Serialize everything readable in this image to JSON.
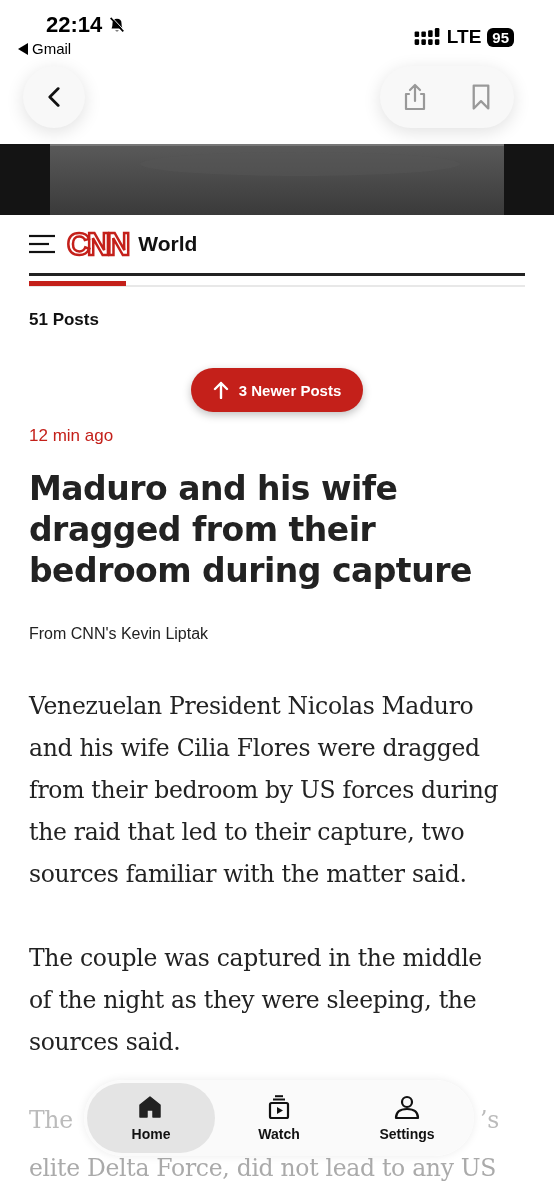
{
  "status_bar": {
    "time": "22:14",
    "back_app": "Gmail",
    "network": "LTE",
    "battery": "95"
  },
  "header": {
    "logo": "CNN",
    "section": "World",
    "progress": {
      "level": 0.195
    }
  },
  "post_count": "51 Posts",
  "newer_posts_button": "3 Newer Posts",
  "post": {
    "time": "12 min ago",
    "headline": "Maduro and his wife dragged from their bedroom during capture",
    "byline": "From CNN's Kevin Liptak",
    "paragraphs": [
      "Venezuelan President Nicolas Maduro and his wife Cilia Flores were dragged from their bedroom by US forces during the raid that led to their capture, two sources familiar with the matter said.",
      "The couple was captured in the middle of the night as they were sleeping, the sources said."
    ],
    "partly_hidden_paragraph": {
      "fragments": [
        "The",
        "’s"
      ],
      "last_line": "elite Delta Force, did not lead to any US"
    }
  },
  "tab_bar": [
    {
      "label": "Home",
      "selected": true
    },
    {
      "label": "Watch",
      "selected": false
    },
    {
      "label": "Settings",
      "selected": false
    }
  ]
}
